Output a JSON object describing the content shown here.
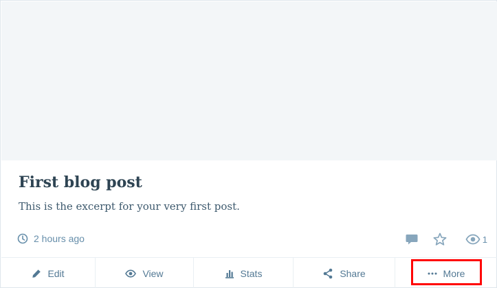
{
  "post": {
    "title": "First blog post",
    "excerpt": "This is the excerpt for your very first post."
  },
  "meta": {
    "time_ago": "2 hours ago",
    "views_count": "1",
    "icons": [
      "clock-icon",
      "comment-icon",
      "star-icon",
      "eye-icon"
    ]
  },
  "controls": {
    "edit_label": "Edit",
    "view_label": "View",
    "stats_label": "Stats",
    "share_label": "Share",
    "more_label": "More"
  },
  "colors": {
    "title": "#2e4453",
    "control_text": "#537994",
    "meta_icon": "#87a6bc",
    "image_placeholder": "#f3f6f8",
    "highlight": "#ff0000"
  }
}
